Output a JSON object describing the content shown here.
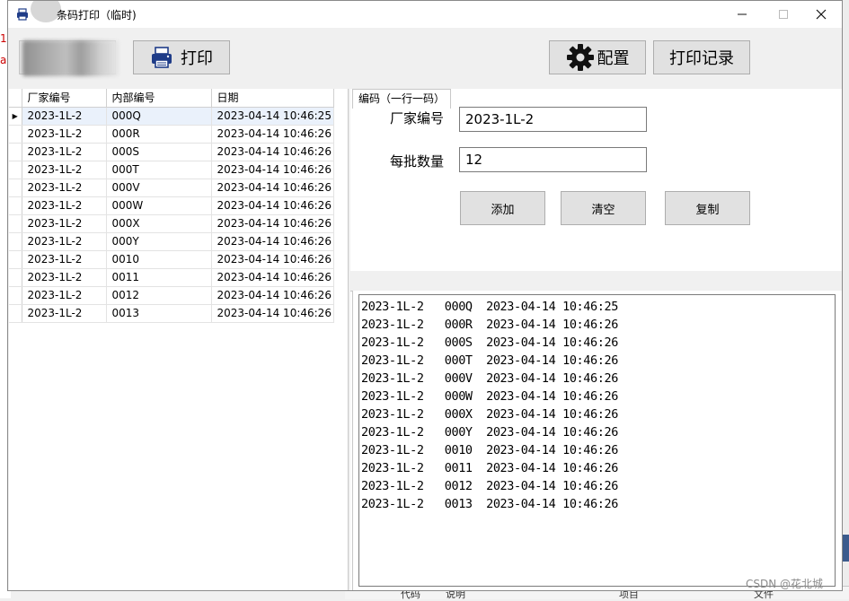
{
  "window": {
    "title": "条码打印（临时)"
  },
  "background_text": {
    "left_1": "1",
    "left_2": "a",
    "bottom_cols": [
      "代码",
      "说明",
      "项目",
      "文件"
    ]
  },
  "toolbar": {
    "print_label": "打印",
    "config_label": "配置",
    "print_log_label": "打印记录"
  },
  "grid": {
    "columns": [
      "厂家编号",
      "内部编号",
      "日期"
    ],
    "selected_row_index": 0,
    "rows": [
      [
        "2023-1L-2",
        "000Q",
        "2023-04-14 10:46:25"
      ],
      [
        "2023-1L-2",
        "000R",
        "2023-04-14 10:46:26"
      ],
      [
        "2023-1L-2",
        "000S",
        "2023-04-14 10:46:26"
      ],
      [
        "2023-1L-2",
        "000T",
        "2023-04-14 10:46:26"
      ],
      [
        "2023-1L-2",
        "000V",
        "2023-04-14 10:46:26"
      ],
      [
        "2023-1L-2",
        "000W",
        "2023-04-14 10:46:26"
      ],
      [
        "2023-1L-2",
        "000X",
        "2023-04-14 10:46:26"
      ],
      [
        "2023-1L-2",
        "000Y",
        "2023-04-14 10:46:26"
      ],
      [
        "2023-1L-2",
        "0010",
        "2023-04-14 10:46:26"
      ],
      [
        "2023-1L-2",
        "0011",
        "2023-04-14 10:46:26"
      ],
      [
        "2023-1L-2",
        "0012",
        "2023-04-14 10:46:26"
      ],
      [
        "2023-1L-2",
        "0013",
        "2023-04-14 10:46:26"
      ]
    ]
  },
  "form": {
    "vendor_label": "厂家编号",
    "vendor_value": "2023-1L-2",
    "batch_label": "每批数量",
    "batch_value": "12",
    "add_label": "添加",
    "clear_label": "清空",
    "copy_label": "复制"
  },
  "codes": {
    "tab_label": "编码（一行一码）",
    "lines": [
      "2023-1L-2   000Q  2023-04-14 10:46:25",
      "2023-1L-2   000R  2023-04-14 10:46:26",
      "2023-1L-2   000S  2023-04-14 10:46:26",
      "2023-1L-2   000T  2023-04-14 10:46:26",
      "2023-1L-2   000V  2023-04-14 10:46:26",
      "2023-1L-2   000W  2023-04-14 10:46:26",
      "2023-1L-2   000X  2023-04-14 10:46:26",
      "2023-1L-2   000Y  2023-04-14 10:46:26",
      "2023-1L-2   0010  2023-04-14 10:46:26",
      "2023-1L-2   0011  2023-04-14 10:46:26",
      "2023-1L-2   0012  2023-04-14 10:46:26",
      "2023-1L-2   0013  2023-04-14 10:46:26"
    ]
  },
  "watermark": "CSDN @花北城",
  "colors": {
    "printer_icon": "#1f3c88",
    "selected_row": "#eaf1fb"
  }
}
